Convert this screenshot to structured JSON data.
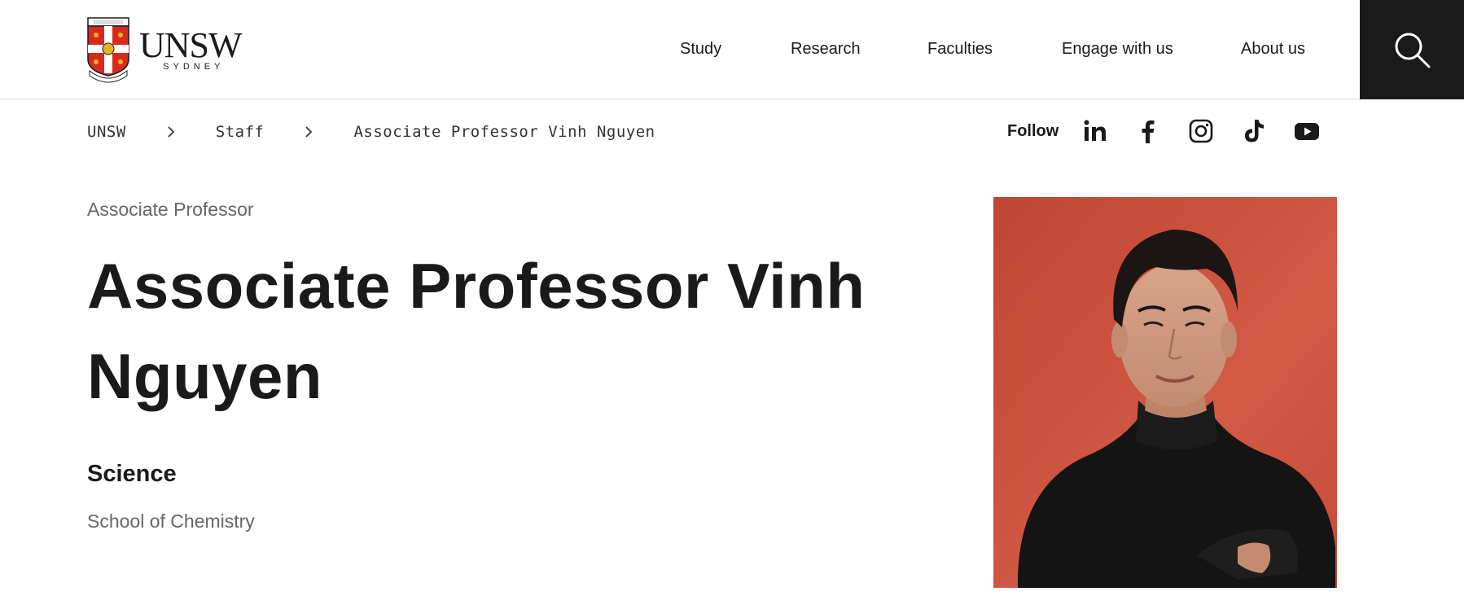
{
  "header": {
    "logo": {
      "wordmark": "UNSW",
      "subtitle": "SYDNEY",
      "crest_icon": "unsw-crest-icon"
    },
    "nav": [
      {
        "label": "Study"
      },
      {
        "label": "Research"
      },
      {
        "label": "Faculties"
      },
      {
        "label": "Engage with us"
      },
      {
        "label": "About us"
      }
    ],
    "search": {
      "icon": "search-icon",
      "bg_color": "#1a1a1a"
    }
  },
  "breadcrumb": [
    {
      "label": "UNSW"
    },
    {
      "label": "Staff"
    },
    {
      "label": "Associate Professor Vinh Nguyen"
    }
  ],
  "follow": {
    "label": "Follow",
    "icons": [
      "linkedin-icon",
      "facebook-icon",
      "instagram-icon",
      "tiktok-icon",
      "youtube-icon"
    ]
  },
  "profile": {
    "eyebrow": "Associate Professor",
    "name": "Associate Professor Vinh Nguyen",
    "faculty": "Science",
    "school": "School of Chemistry",
    "photo_bg_color": "#c9503d"
  },
  "colors": {
    "text": "#1a1a1a",
    "muted": "#666666",
    "crest_red": "#d8291f",
    "crest_gold": "#e8b31a"
  }
}
